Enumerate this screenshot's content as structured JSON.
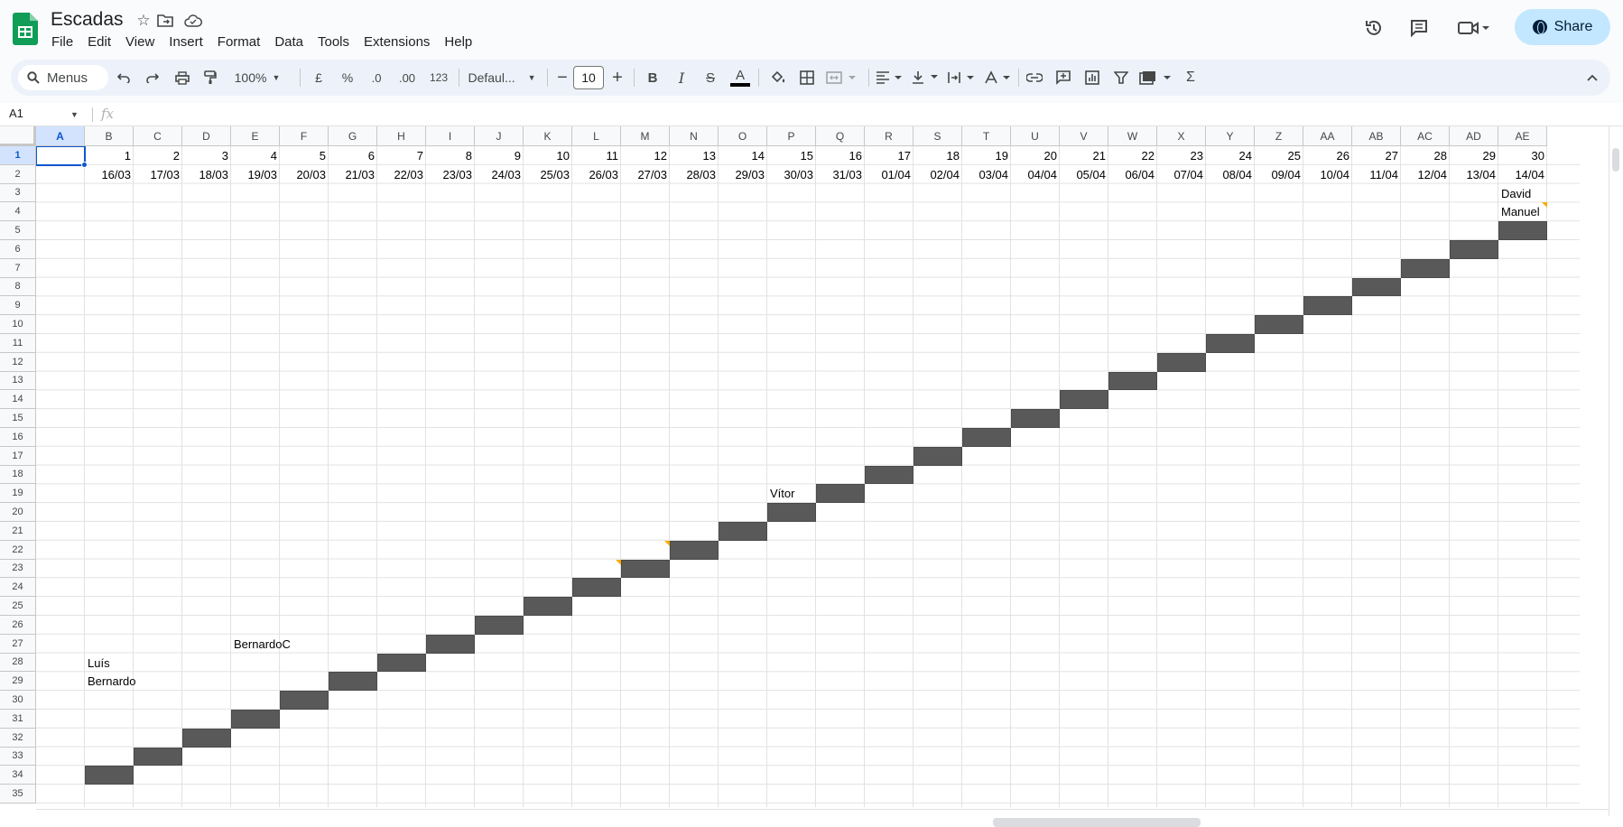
{
  "app": {
    "title": "Escadas",
    "menus": [
      "File",
      "Edit",
      "View",
      "Insert",
      "Format",
      "Data",
      "Tools",
      "Extensions",
      "Help"
    ],
    "share_label": "Share",
    "accent": "#0b57d0",
    "share_bg": "#c2e7ff"
  },
  "toolbar": {
    "search_label": "Menus",
    "zoom": "100%",
    "currency": "£",
    "percent": "%",
    "dec_decrease": ".0",
    "dec_increase": ".00",
    "number_format": "123",
    "font": "Defaul...",
    "font_size": "10",
    "bold": "B",
    "italic": "I",
    "strike": "S",
    "text_color": "A",
    "sum": "Σ"
  },
  "formula_bar": {
    "name_box": "A1",
    "fx": "fx",
    "value": ""
  },
  "sheet": {
    "columns": [
      "A",
      "B",
      "C",
      "D",
      "E",
      "F",
      "G",
      "H",
      "I",
      "J",
      "K",
      "L",
      "M",
      "N",
      "O",
      "P",
      "Q",
      "R",
      "S",
      "T",
      "U",
      "V",
      "W",
      "X",
      "Y",
      "Z",
      "AA",
      "AB",
      "AC",
      "AD",
      "AE"
    ],
    "rows": [
      "1",
      "2",
      "3",
      "4",
      "5",
      "6",
      "7",
      "8",
      "9",
      "10",
      "11",
      "12",
      "13",
      "14",
      "15",
      "16",
      "17",
      "18",
      "19",
      "20",
      "21",
      "22",
      "23",
      "24",
      "25",
      "26",
      "27",
      "28",
      "29",
      "30",
      "31",
      "32",
      "33",
      "34",
      "35"
    ],
    "row1_numbers": [
      "1",
      "2",
      "3",
      "4",
      "5",
      "6",
      "7",
      "8",
      "9",
      "10",
      "11",
      "12",
      "13",
      "14",
      "15",
      "16",
      "17",
      "18",
      "19",
      "20",
      "21",
      "22",
      "23",
      "24",
      "25",
      "26",
      "27",
      "28",
      "29",
      "30"
    ],
    "row2_dates": [
      "16/03",
      "17/03",
      "18/03",
      "19/03",
      "20/03",
      "21/03",
      "22/03",
      "23/03",
      "24/03",
      "25/03",
      "26/03",
      "27/03",
      "28/03",
      "29/03",
      "30/03",
      "31/03",
      "01/04",
      "02/04",
      "03/04",
      "04/04",
      "05/04",
      "06/04",
      "07/04",
      "08/04",
      "09/04",
      "10/04",
      "11/04",
      "12/04",
      "13/04",
      "14/04"
    ],
    "text_cells": [
      {
        "col": 30,
        "row": 3,
        "text": "David"
      },
      {
        "col": 30,
        "row": 4,
        "text": "Manuel"
      },
      {
        "col": 15,
        "row": 19,
        "text": "Vítor"
      },
      {
        "col": 4,
        "row": 27,
        "text": "BernardoC"
      },
      {
        "col": 1,
        "row": 28,
        "text": "Luís"
      },
      {
        "col": 1,
        "row": 29,
        "text": "Bernardo"
      }
    ],
    "filled_cells": [
      {
        "col": 1,
        "row": 34
      },
      {
        "col": 2,
        "row": 33
      },
      {
        "col": 3,
        "row": 32
      },
      {
        "col": 4,
        "row": 31
      },
      {
        "col": 5,
        "row": 30
      },
      {
        "col": 6,
        "row": 29
      },
      {
        "col": 7,
        "row": 28
      },
      {
        "col": 8,
        "row": 27
      },
      {
        "col": 9,
        "row": 26
      },
      {
        "col": 10,
        "row": 25
      },
      {
        "col": 11,
        "row": 24
      },
      {
        "col": 12,
        "row": 23
      },
      {
        "col": 13,
        "row": 22
      },
      {
        "col": 14,
        "row": 21
      },
      {
        "col": 15,
        "row": 20
      },
      {
        "col": 16,
        "row": 19
      },
      {
        "col": 17,
        "row": 18
      },
      {
        "col": 18,
        "row": 17
      },
      {
        "col": 19,
        "row": 16
      },
      {
        "col": 20,
        "row": 15
      },
      {
        "col": 21,
        "row": 14
      },
      {
        "col": 22,
        "row": 13
      },
      {
        "col": 23,
        "row": 12
      },
      {
        "col": 24,
        "row": 11
      },
      {
        "col": 25,
        "row": 10
      },
      {
        "col": 26,
        "row": 9
      },
      {
        "col": 27,
        "row": 8
      },
      {
        "col": 28,
        "row": 7
      },
      {
        "col": 29,
        "row": 6
      },
      {
        "col": 30,
        "row": 5
      }
    ],
    "note_cells": [
      {
        "col": 30,
        "row": 4
      },
      {
        "col": 12,
        "row": 22
      },
      {
        "col": 11,
        "row": 23
      }
    ],
    "fill_color": "#595959",
    "note_color": "#f9ab00"
  }
}
